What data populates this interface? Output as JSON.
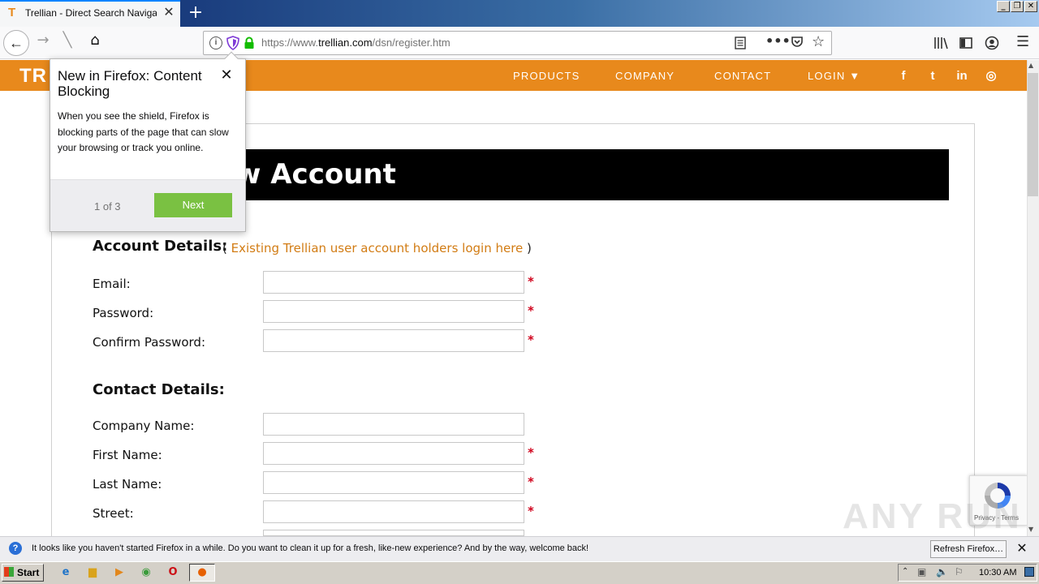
{
  "browser": {
    "tab_title": "Trellian - Direct Search Navigation",
    "tab_favicon": "T",
    "url_prefix": "https://www.",
    "url_host": "trellian.com",
    "url_path": "/dsn/register.htm"
  },
  "site": {
    "logo": "TR",
    "nav": {
      "products": "PRODUCTS",
      "company": "COMPANY",
      "contact": "CONTACT",
      "login": "LOGIN ▼"
    },
    "social": {
      "facebook": "f",
      "twitter": "t",
      "linkedin": "in",
      "instagram": "◎"
    },
    "accent_color": "#e8891c"
  },
  "page": {
    "title_visible": "w Account",
    "account_heading": "Account Details:",
    "existing_open": "( ",
    "existing_link": "Existing Trellian user account holders login here",
    "existing_close": " )",
    "contact_heading": "Contact Details:",
    "fields": {
      "email": "Email:",
      "password": "Password:",
      "confirm_password": "Confirm Password:",
      "company": "Company Name:",
      "first_name": "First Name:",
      "last_name": "Last Name:",
      "street": "Street:"
    },
    "required_mark": "*"
  },
  "popup": {
    "title": "New in Firefox: Content Blocking",
    "body": "When you see the shield, Firefox is blocking parts of the page that can slow your browsing or track you online.",
    "step": "1 of 3",
    "next": "Next",
    "next_color": "#7ac142"
  },
  "recaptcha": {
    "terms": "Privacy - Terms"
  },
  "watermark": "ANY RUN",
  "notification": {
    "text": "It looks like you haven't started Firefox in a while. Do you want to clean it up for a fresh, like-new experience? And by the way, welcome back!",
    "button": "Refresh Firefox…"
  },
  "taskbar": {
    "start": "Start",
    "clock": "10:30 AM"
  }
}
